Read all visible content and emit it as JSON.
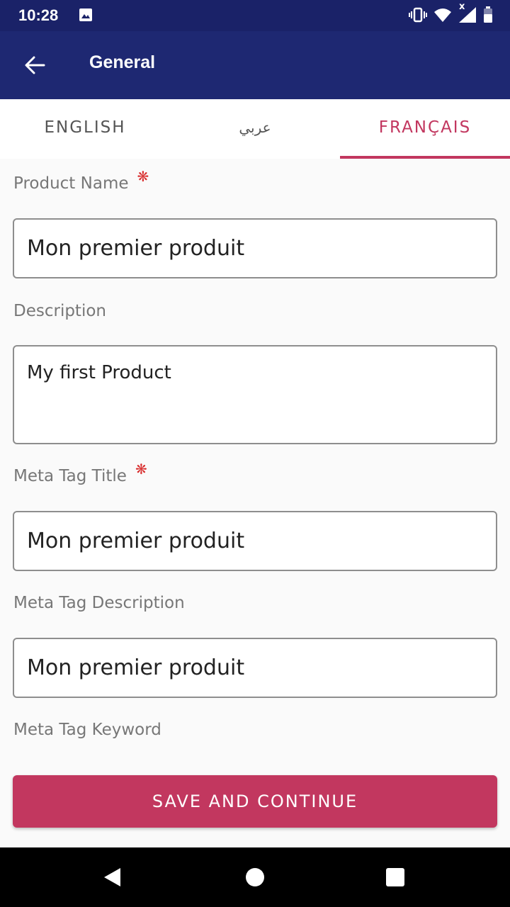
{
  "status_bar": {
    "time": "10:28",
    "network_badge": "x"
  },
  "app_bar": {
    "title": "General"
  },
  "tabs": [
    {
      "label": "ENGLISH",
      "active": false
    },
    {
      "label": "عربي",
      "active": false
    },
    {
      "label": "FRANÇAIS",
      "active": true
    }
  ],
  "form": {
    "required_marker": "❋",
    "product_name": {
      "label": "Product Name",
      "value": "Mon premier produit"
    },
    "description": {
      "label": "Description",
      "value": "My first Product"
    },
    "meta_tag_title": {
      "label": "Meta Tag Title",
      "value": "Mon premier produit"
    },
    "meta_tag_description": {
      "label": "Meta Tag Description",
      "value": "Mon premier produit"
    },
    "meta_tag_keyword": {
      "label": "Meta Tag Keyword"
    }
  },
  "save_button": {
    "label": "SAVE AND CONTINUE"
  },
  "colors": {
    "primary": "#1e2872",
    "status": "#1a2268",
    "accent": "#c2375f",
    "required": "#d93030"
  }
}
